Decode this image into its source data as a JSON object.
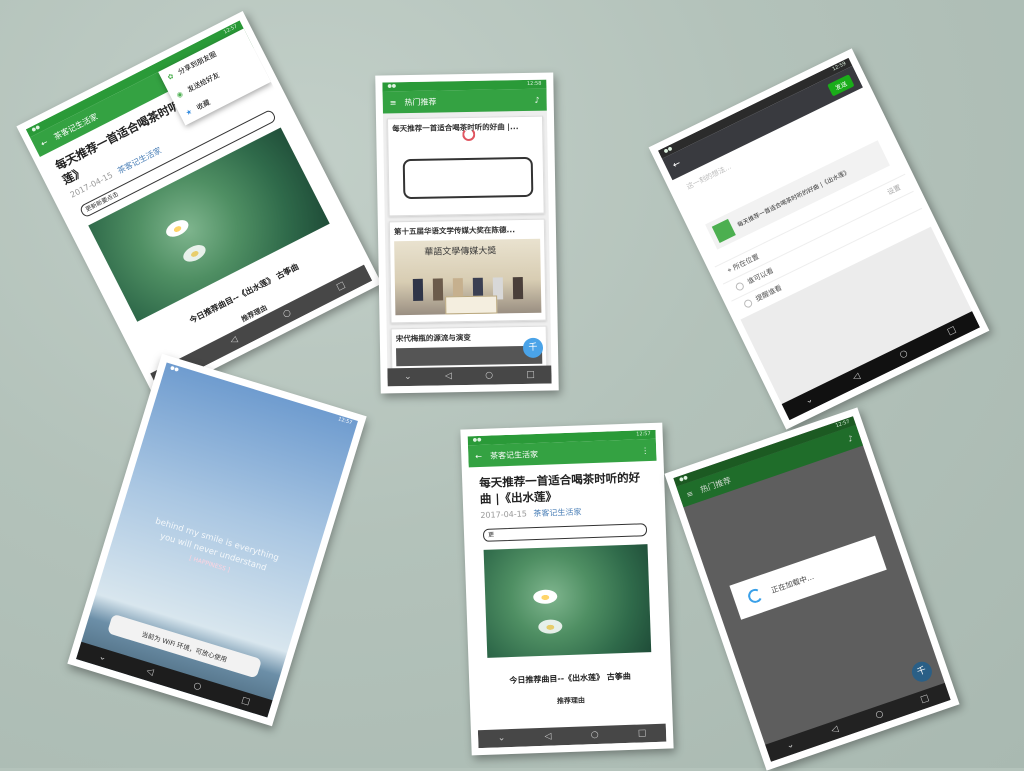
{
  "card1": {
    "appbar_title": "茶客记生活家",
    "menu": [
      {
        "icon": "moments-icon",
        "label": "分享到朋友圈"
      },
      {
        "icon": "wechat-friend-icon",
        "label": "发送给好友"
      },
      {
        "icon": "star-icon",
        "label": "收藏"
      }
    ],
    "article_title": "每天推荐一首适合喝茶时听的好曲 |《出水莲》",
    "date": "2017-04-15",
    "author": "茶客记生活家",
    "bubble_text": "更新新要点击",
    "caption": "今日推荐曲目--《出水莲》 古筝曲",
    "footer": "推荐理由"
  },
  "card2": {
    "appbar_title": "热门推荐",
    "items": [
      {
        "title": "每天推荐一首适合喝茶时听的好曲 |..."
      },
      {
        "title": "第十五届华语文学传媒大奖在陈德..."
      },
      {
        "title": "宋代梅瓶的源流与演变"
      }
    ],
    "banner_text": "華語文學傳媒大獎",
    "fab_label": "千"
  },
  "card3": {
    "send_button": "发送",
    "input_placeholder": "这一刻的想法...",
    "shared_title": "每天推荐一首适合喝茶时听的好曲 |《出水莲》",
    "location_label": "所在位置",
    "location_hint": "设置",
    "visibility_label": "谁可以看",
    "remind_label": "提醒谁看"
  },
  "card4": {
    "quote_line1": "behind my smile is everything",
    "quote_line2": "you will never understand",
    "quote_line3": "[ HAPPINESS ]",
    "toast": "当前为 WiFi 环境，可放心使用"
  },
  "card5": {
    "appbar_title": "茶客记生活家",
    "article_title": "每天推荐一首适合喝茶时听的好曲 |《出水莲》",
    "date": "2017-04-15",
    "author": "茶客记生活家",
    "bubble_text": "更",
    "caption": "今日推荐曲目--《出水莲》 古筝曲",
    "footer": "推荐理由"
  },
  "card6": {
    "appbar_title": "热门推荐",
    "loading_text": "正在加载中...",
    "fab_label": "千"
  },
  "colors": {
    "brand_green": "#34a242",
    "status_green": "#2a9a38",
    "link_blue": "#4a7fb7",
    "fab_blue": "#4aa3e8"
  }
}
